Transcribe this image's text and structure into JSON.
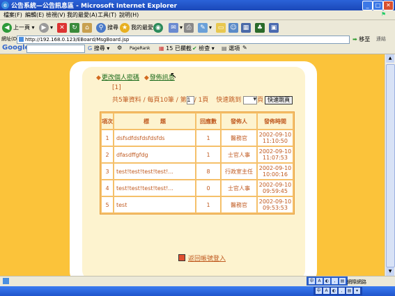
{
  "window": {
    "title": "公告系統—公告訊息區 - Microsoft Internet Explorer",
    "ie_icon": "e"
  },
  "menu": [
    "檔案(F)",
    "編輯(E)",
    "檢視(V)",
    "我的最愛(A)",
    "工具(T)",
    "說明(H)"
  ],
  "toolbar": {
    "back": "上一頁",
    "search": "搜尋",
    "favorites": "我的最愛"
  },
  "address": {
    "label": "網址(D)",
    "url": "http://192.168.0.123/EBoard/MsgBoard.jsp",
    "go": "移至",
    "links": "連結"
  },
  "googlebar": {
    "logo": "Google",
    "search": "搜尋",
    "pagerank": "PageRank",
    "blocked": "15 已攔截",
    "check": "檢查",
    "options": "選項"
  },
  "page": {
    "link_change_password": "更改個人密碼",
    "link_publish": "發佈訊息",
    "page_indicator": "[1]",
    "summary_prefix": "共5筆資料 / 每頁10筆 / 第",
    "current_page": "1",
    "summary_suffix": "/ 1頁",
    "jump_label": "快速跳到",
    "jump_suffix": "頁",
    "jump_button": "快速跳頁",
    "return_link": "返回帳號登入"
  },
  "table": {
    "headers": {
      "no": "項次",
      "title": "標　　題",
      "replies": "回應數",
      "author": "發佈人",
      "time": "發佈時間"
    },
    "rows": [
      {
        "no": "1",
        "title": "dsfsdfdsfdsfdsfds",
        "replies": "1",
        "author": "醫務官",
        "date": "2002-09-10",
        "time": "11:10:50"
      },
      {
        "no": "2",
        "title": "dfasdffgfdg",
        "replies": "1",
        "author": "士官人事",
        "date": "2002-09-10",
        "time": "11:07:53"
      },
      {
        "no": "3",
        "title": "test!test!test!test!...",
        "replies": "8",
        "author": "行政室主任",
        "date": "2002-09-10",
        "time": "10:00:16"
      },
      {
        "no": "4",
        "title": "test!test!test!test!...",
        "replies": "0",
        "author": "士官人事",
        "date": "2002-09-10",
        "time": "09:59:45"
      },
      {
        "no": "5",
        "title": "test",
        "replies": "1",
        "author": "醫務官",
        "date": "2002-09-10",
        "time": "09:53:53"
      }
    ]
  },
  "status": {
    "zone": "網際網路"
  }
}
